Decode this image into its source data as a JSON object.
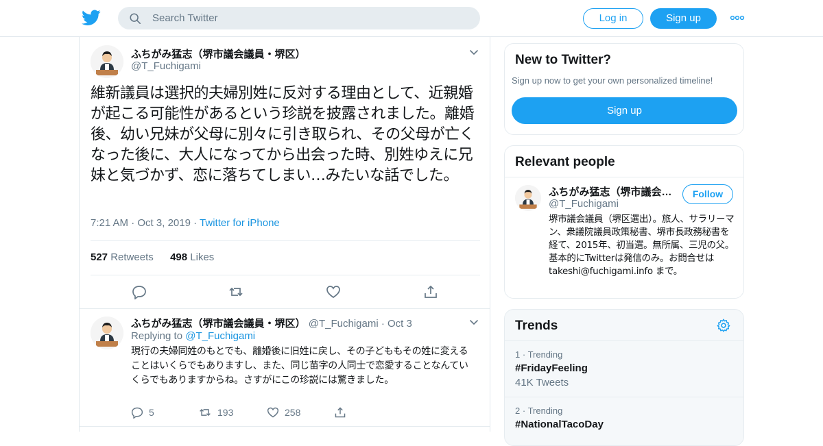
{
  "header": {
    "search_placeholder": "Search Twitter",
    "login_label": "Log in",
    "signup_label": "Sign up"
  },
  "tweet": {
    "author_name": "ふちがみ猛志（堺市議会議員・堺区）",
    "author_handle": "@T_Fuchigami",
    "text": "維新議員は選択的夫婦別姓に反対する理由として、近親婚が起こる可能性があるという珍説を披露されました。離婚後、幼い兄妹が父母に別々に引き取られ、その父母が亡くなった後に、大人になってから出会った時、別姓ゆえに兄妹と気づかず、恋に落ちてしまい…みたいな話でした。",
    "time": "7:21 AM",
    "date": "Oct 3, 2019",
    "source": "Twitter for iPhone",
    "retweet_count": "527",
    "retweet_label": "Retweets",
    "like_count": "498",
    "like_label": "Likes"
  },
  "reply": {
    "author_name": "ふちがみ猛志（堺市議会議員・堺区）",
    "author_handle": "@T_Fuchigami",
    "date": "Oct 3",
    "replying_label": "Replying to",
    "replying_handle": "@T_Fuchigami",
    "text": "現行の夫婦同姓のもとでも、離婚後に旧姓に戻し、その子どももその姓に変えることはいくらでもありますし、また、同じ苗字の人同士で恋愛することなんていくらでもありますからね。さすがにこの珍説には驚きました。",
    "reply_count": "5",
    "retweet_count": "193",
    "like_count": "258"
  },
  "new_to_twitter": {
    "title": "New to Twitter?",
    "subtitle": "Sign up now to get your own personalized timeline!",
    "signup_label": "Sign up"
  },
  "relevant_people": {
    "title": "Relevant people",
    "name": "ふちがみ猛志（堺市議会…",
    "handle": "@T_Fuchigami",
    "follow_label": "Follow",
    "bio": "堺市議会議員（堺区選出）。旅人、サラリーマン、衆議院議員政策秘書、堺市長政務秘書を経て、2015年、初当選。無所属、三児の父。基本的にTwitterは発信のみ。お問合せは takeshi@fuchigami.info まで。"
  },
  "trends": {
    "title": "Trends",
    "items": [
      {
        "rank": "1",
        "label": "Trending",
        "name": "#FridayFeeling",
        "count": "41K Tweets"
      },
      {
        "rank": "2",
        "label": "Trending",
        "name": "#NationalTacoDay",
        "count": ""
      }
    ]
  },
  "colors": {
    "accent": "#1da1f2",
    "link": "#1b95e0",
    "secondary_text": "#657786",
    "border": "#e6ecf0"
  }
}
